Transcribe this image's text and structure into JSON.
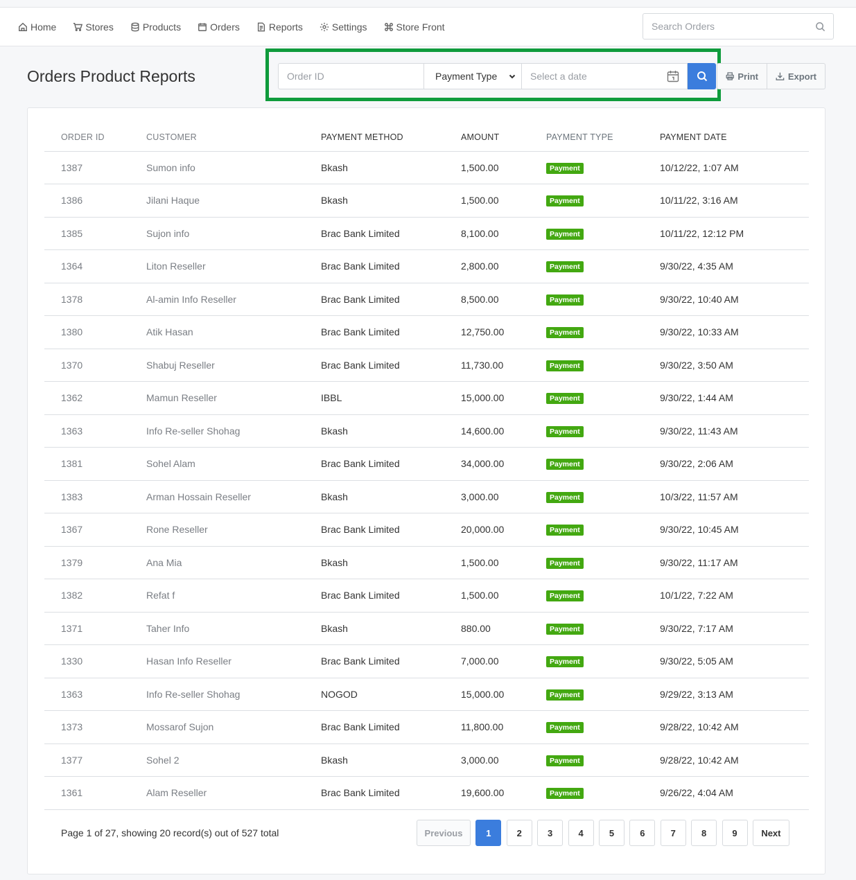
{
  "nav": {
    "items": [
      {
        "label": "Home",
        "icon": "home-icon"
      },
      {
        "label": "Stores",
        "icon": "cart-icon"
      },
      {
        "label": "Products",
        "icon": "database-icon"
      },
      {
        "label": "Orders",
        "icon": "calendar-icon"
      },
      {
        "label": "Reports",
        "icon": "document-icon"
      },
      {
        "label": "Settings",
        "icon": "gear-icon"
      },
      {
        "label": "Store Front",
        "icon": "command-icon"
      }
    ],
    "search_placeholder": "Search Orders"
  },
  "page": {
    "title": "Orders Product Reports"
  },
  "filters": {
    "order_id_placeholder": "Order ID",
    "payment_type_selected": "Payment Type",
    "date_placeholder": "Select a date",
    "highlight_color": "#0f9b3c"
  },
  "toolbar": {
    "print_label": "Print",
    "export_label": "Export"
  },
  "table": {
    "headers": [
      "ORDER ID",
      "CUSTOMER",
      "PAYMENT METHOD",
      "AMOUNT",
      "PAYMENT TYPE",
      "PAYMENT DATE"
    ],
    "rows": [
      {
        "id": "1387",
        "customer": "Sumon info",
        "method": "Bkash",
        "amount": "1,500.00",
        "type": "Payment",
        "date": "10/12/22, 1:07 AM"
      },
      {
        "id": "1386",
        "customer": "Jilani Haque",
        "method": "Bkash",
        "amount": "1,500.00",
        "type": "Payment",
        "date": "10/11/22, 3:16 AM"
      },
      {
        "id": "1385",
        "customer": "Sujon info",
        "method": "Brac Bank Limited",
        "amount": "8,100.00",
        "type": "Payment",
        "date": "10/11/22, 12:12 PM"
      },
      {
        "id": "1364",
        "customer": "Liton Reseller",
        "method": "Brac Bank Limited",
        "amount": "2,800.00",
        "type": "Payment",
        "date": "9/30/22, 4:35 AM"
      },
      {
        "id": "1378",
        "customer": "Al-amin Info Reseller",
        "method": "Brac Bank Limited",
        "amount": "8,500.00",
        "type": "Payment",
        "date": "9/30/22, 10:40 AM"
      },
      {
        "id": "1380",
        "customer": "Atik Hasan",
        "method": "Brac Bank Limited",
        "amount": "12,750.00",
        "type": "Payment",
        "date": "9/30/22, 10:33 AM"
      },
      {
        "id": "1370",
        "customer": "Shabuj Reseller",
        "method": "Brac Bank Limited",
        "amount": "11,730.00",
        "type": "Payment",
        "date": "9/30/22, 3:50 AM"
      },
      {
        "id": "1362",
        "customer": "Mamun Reseller",
        "method": "IBBL",
        "amount": "15,000.00",
        "type": "Payment",
        "date": "9/30/22, 1:44 AM"
      },
      {
        "id": "1363",
        "customer": "Info Re-seller Shohag",
        "method": "Bkash",
        "amount": "14,600.00",
        "type": "Payment",
        "date": "9/30/22, 11:43 AM"
      },
      {
        "id": "1381",
        "customer": "Sohel Alam",
        "method": "Brac Bank Limited",
        "amount": "34,000.00",
        "type": "Payment",
        "date": "9/30/22, 2:06 AM"
      },
      {
        "id": "1383",
        "customer": "Arman Hossain Reseller",
        "method": "Bkash",
        "amount": "3,000.00",
        "type": "Payment",
        "date": "10/3/22, 11:57 AM"
      },
      {
        "id": "1367",
        "customer": "Rone Reseller",
        "method": "Brac Bank Limited",
        "amount": "20,000.00",
        "type": "Payment",
        "date": "9/30/22, 10:45 AM"
      },
      {
        "id": "1379",
        "customer": "Ana Mia",
        "method": "Bkash",
        "amount": "1,500.00",
        "type": "Payment",
        "date": "9/30/22, 11:17 AM"
      },
      {
        "id": "1382",
        "customer": "Refat f",
        "method": "Brac Bank Limited",
        "amount": "1,500.00",
        "type": "Payment",
        "date": "10/1/22, 7:22 AM"
      },
      {
        "id": "1371",
        "customer": "Taher Info",
        "method": "Bkash",
        "amount": "880.00",
        "type": "Payment",
        "date": "9/30/22, 7:17 AM"
      },
      {
        "id": "1330",
        "customer": "Hasan Info Reseller",
        "method": "Brac Bank Limited",
        "amount": "7,000.00",
        "type": "Payment",
        "date": "9/30/22, 5:05 AM"
      },
      {
        "id": "1363",
        "customer": "Info Re-seller Shohag",
        "method": "NOGOD",
        "amount": "15,000.00",
        "type": "Payment",
        "date": "9/29/22, 3:13 AM"
      },
      {
        "id": "1373",
        "customer": "Mossarof Sujon",
        "method": "Brac Bank Limited",
        "amount": "11,800.00",
        "type": "Payment",
        "date": "9/28/22, 10:42 AM"
      },
      {
        "id": "1377",
        "customer": "Sohel 2",
        "method": "Bkash",
        "amount": "3,000.00",
        "type": "Payment",
        "date": "9/28/22, 10:42 AM"
      },
      {
        "id": "1361",
        "customer": "Alam Reseller",
        "method": "Brac Bank Limited",
        "amount": "19,600.00",
        "type": "Payment",
        "date": "9/26/22, 4:04 AM"
      }
    ],
    "badge_color": "#43a811"
  },
  "footer": {
    "summary": "Page 1 of 27, showing 20 record(s) out of 527 total"
  },
  "pagination": {
    "previous_label": "Previous",
    "pages": [
      "1",
      "2",
      "3",
      "4",
      "5",
      "6",
      "7",
      "8",
      "9"
    ],
    "active_page": "1",
    "next_label": "Next",
    "accent_color": "#3b7ddd"
  }
}
